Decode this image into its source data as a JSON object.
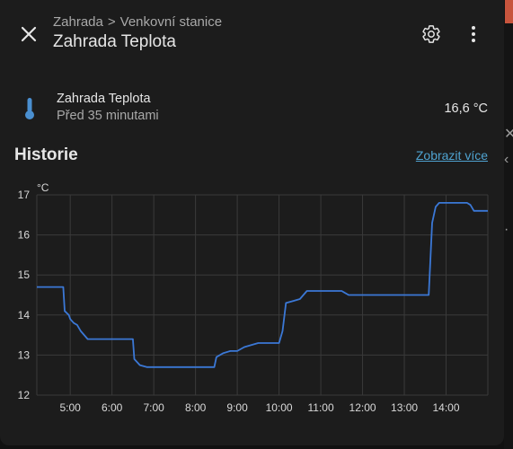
{
  "header": {
    "breadcrumb_area": "Zahrada",
    "breadcrumb_sep": ">",
    "breadcrumb_device": "Venkovní stanice",
    "title": "Zahrada Teplota",
    "close_icon": "close-icon",
    "settings_icon": "gear-icon",
    "menu_icon": "more-vertical-icon"
  },
  "entity": {
    "name": "Zahrada Teplota",
    "last_changed": "Před 35 minutami",
    "value": "16,6 °C",
    "icon": "thermometer-icon"
  },
  "history": {
    "title": "Historie",
    "show_more": "Zobrazit více"
  },
  "colors": {
    "line": "#3b78d6",
    "accent_link": "#4fa3d1",
    "background": "#1c1c1c"
  },
  "chart_data": {
    "type": "line",
    "ylabel": "°C",
    "ylim": [
      12,
      17
    ],
    "yticks": [
      "12",
      "13",
      "14",
      "15",
      "16",
      "17"
    ],
    "xticks": [
      "5:00",
      "6:00",
      "7:00",
      "8:00",
      "9:00",
      "10:00",
      "11:00",
      "12:00",
      "13:00",
      "14:00"
    ],
    "xlim": [
      "4:12",
      "15:00"
    ],
    "grid": true,
    "series": [
      {
        "x": [
          "4:12",
          "4:50",
          "4:52",
          "4:58",
          "5:00",
          "5:05",
          "5:10",
          "5:15",
          "5:20",
          "5:25",
          "6:00",
          "6:30",
          "6:32",
          "6:40",
          "6:50",
          "7:00",
          "7:30",
          "8:00",
          "8:27",
          "8:30",
          "8:40",
          "8:50",
          "9:00",
          "9:10",
          "9:20",
          "9:30",
          "9:45",
          "10:00",
          "10:05",
          "10:10",
          "10:20",
          "10:30",
          "10:40",
          "11:00",
          "11:30",
          "11:40",
          "12:00",
          "12:30",
          "13:00",
          "13:30",
          "13:35",
          "13:40",
          "13:45",
          "13:50",
          "14:00",
          "14:30",
          "14:35",
          "14:40",
          "15:00"
        ],
        "y": [
          14.7,
          14.7,
          14.1,
          14.0,
          13.9,
          13.8,
          13.75,
          13.6,
          13.5,
          13.4,
          13.4,
          13.4,
          12.9,
          12.75,
          12.7,
          12.7,
          12.7,
          12.7,
          12.7,
          12.95,
          13.05,
          13.1,
          13.1,
          13.2,
          13.25,
          13.3,
          13.3,
          13.3,
          13.6,
          14.3,
          14.35,
          14.4,
          14.6,
          14.6,
          14.6,
          14.5,
          14.5,
          14.5,
          14.5,
          14.5,
          14.5,
          16.3,
          16.7,
          16.8,
          16.8,
          16.8,
          16.75,
          16.6,
          16.6
        ]
      }
    ]
  }
}
